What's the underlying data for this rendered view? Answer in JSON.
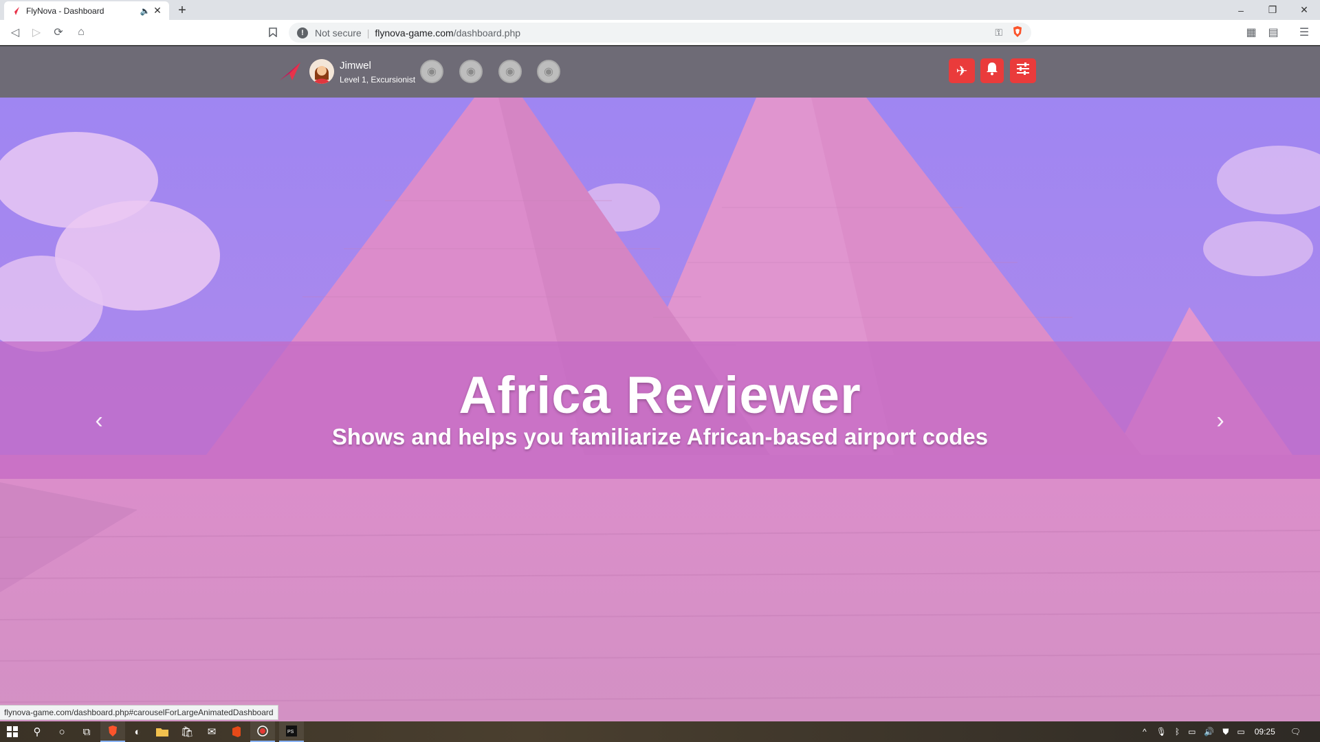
{
  "browser": {
    "tab_title": "FlyNova - Dashboard",
    "url_security": "Not secure",
    "url_host": "flynova-game.com",
    "url_path": "/dashboard.php",
    "status_url": "flynova-game.com/dashboard.php#carouselForLargeAnimatedDashboard"
  },
  "header": {
    "user_name": "Jimwel",
    "user_level": "Level 1, Excursionist",
    "badges": [
      "badge-1",
      "badge-2",
      "badge-3",
      "badge-4"
    ],
    "buttons": [
      "plane-icon",
      "bell-icon",
      "sliders-icon"
    ],
    "accent": "#ea3b3b"
  },
  "carousel": {
    "title": "Africa Reviewer",
    "subtitle": "Shows and helps you familiarize African-based airport codes",
    "prev_symbol": "‹",
    "next_symbol": "›"
  },
  "taskbar": {
    "time": "09:25"
  }
}
